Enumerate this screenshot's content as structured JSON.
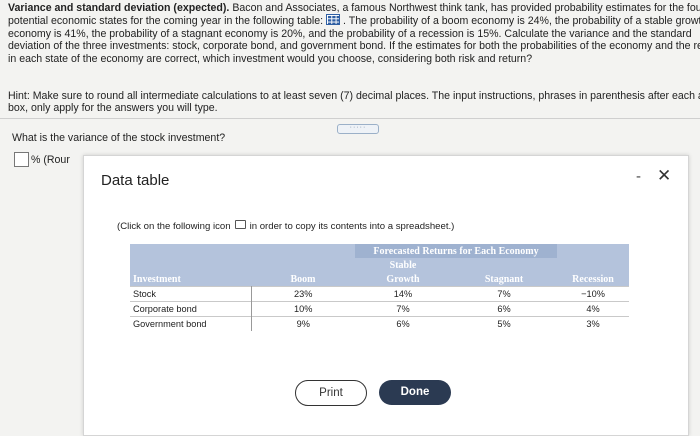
{
  "problem": {
    "title": "Variance and standard deviation (expected).",
    "line1_rest": "Bacon and Associates, a famous Northwest think tank, has provided probability estimates for the four",
    "line2_a": "potential economic states for the coming year in the following table:",
    "line2_b": ". The probability of a boom economy is 24%, the probability of a stable growth",
    "line3": "economy is 41%, the probability of a stagnant economy is 20%, and the probability of a recession is 15%. Calculate the variance and the standard",
    "line4": "deviation of the three investments: stock, corporate bond, and government bond. If the estimates for both the probabilities of the economy and the returns",
    "line5": "in each state of the economy are correct, which investment would you choose, considering both risk and return?"
  },
  "hint": {
    "line1": "Hint: Make sure to round all intermediate calculations to at least seven (7) decimal places. The input instructions, phrases in parenthesis after each answe",
    "line2": "box, only apply for the answers you will type."
  },
  "question": "What is the variance of the stock investment?",
  "answer_suffix": "% (Rour",
  "dialog": {
    "title": "Data table",
    "minimize": "-",
    "close": "✕",
    "instruction_before": "(Click on the following icon",
    "instruction_after": "in order to copy its contents into a spreadsheet.)",
    "table": {
      "group_header": "Forecasted Returns for Each Economy",
      "col_investment": "Investment",
      "col_boom": "Boom",
      "col_stable_1": "Stable",
      "col_stable_2": "Growth",
      "col_stagnant": "Stagnant",
      "col_recession": "Recession",
      "rows": [
        {
          "name": "Stock",
          "boom": "23%",
          "stable": "14%",
          "stagnant": "7%",
          "recession": "−10%"
        },
        {
          "name": "Corporate bond",
          "boom": "10%",
          "stable": "7%",
          "stagnant": "6%",
          "recession": "4%"
        },
        {
          "name": "Government bond",
          "boom": "9%",
          "stable": "6%",
          "stagnant": "5%",
          "recession": "3%"
        }
      ]
    },
    "print_label": "Print",
    "done_label": "Done"
  }
}
